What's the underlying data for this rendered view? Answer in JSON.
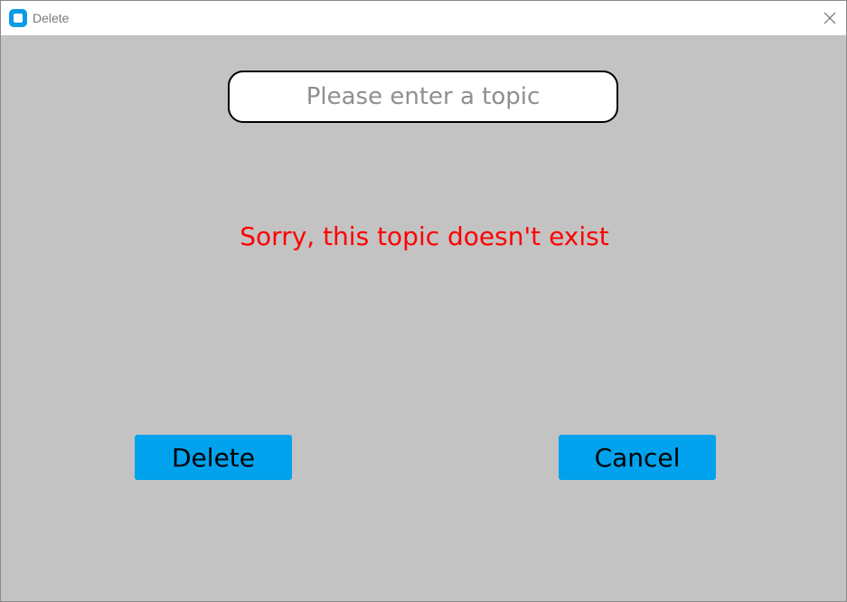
{
  "window": {
    "title": "Delete",
    "icon": "app-icon",
    "close_icon": "close-icon"
  },
  "form": {
    "topic_input": {
      "value": "",
      "placeholder": "Please enter a topic"
    },
    "error_message": "Sorry, this topic doesn't exist"
  },
  "buttons": {
    "delete_label": "Delete",
    "cancel_label": "Cancel"
  },
  "colors": {
    "background": "#c3c3c3",
    "button": "#00a2ed",
    "error_text": "#ff0000",
    "app_icon": "#0a9be8"
  }
}
